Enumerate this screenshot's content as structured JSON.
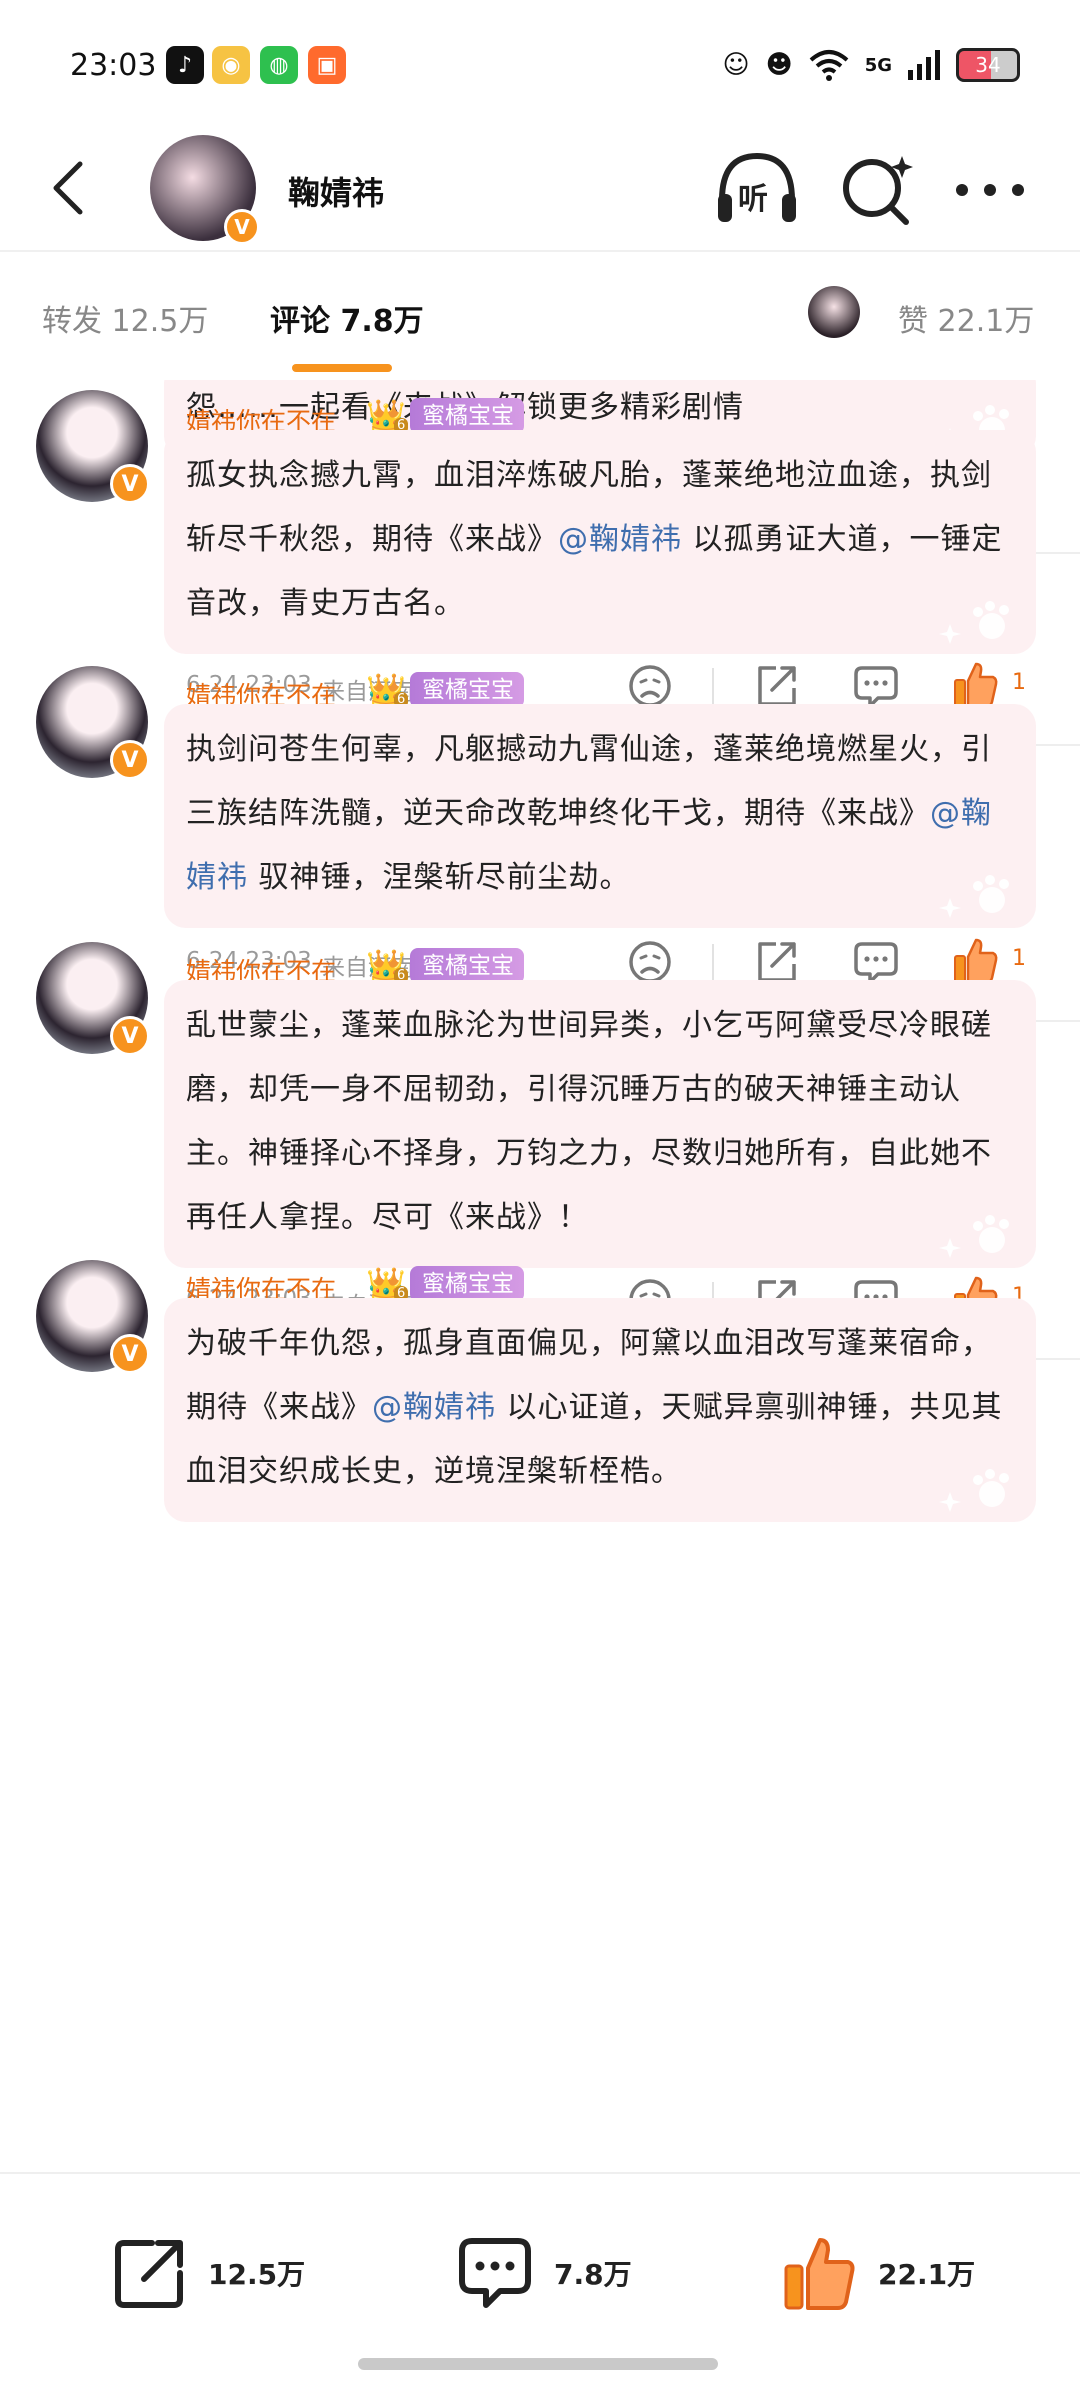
{
  "status_bar": {
    "time": "23:03",
    "network": "5G",
    "battery": "34",
    "app_icons": [
      "tiktok-icon",
      "weibo-icon",
      "wechat-icon",
      "camera-app-icon"
    ]
  },
  "header": {
    "title": "鞠婧祎",
    "listen_label": "听",
    "verified_mark": "V"
  },
  "tabs": {
    "forward": "转发 12.5万",
    "comment": "评论 7.8万",
    "like": "赞 22.1万"
  },
  "accent_color": "#f7931e",
  "comments": [
    {
      "name": "",
      "badge": "",
      "medal_level": "",
      "text_parts": [
        {
          "t": "怨……一起看《来战》解锁更多精彩剧情",
          "m": false
        }
      ],
      "time": "6-24 23:03",
      "location": "来自河南",
      "likes": "1"
    },
    {
      "name": "婧祎你在不在_",
      "badge": "蜜橘宝宝",
      "medal_level": "6",
      "text_parts": [
        {
          "t": "孤女执念撼九霄，血泪淬炼破凡胎，蓬莱绝地泣血途，执剑斩尽千秋怨，期待《来战》",
          "m": false
        },
        {
          "t": "@鞠婧祎",
          "m": true
        },
        {
          "t": " 以孤勇证大道，一锤定音改，青史万古名。",
          "m": false
        }
      ],
      "time": "6-24 23:03",
      "location": "来自河南",
      "likes": "1"
    },
    {
      "name": "婧祎你在不在_",
      "badge": "蜜橘宝宝",
      "medal_level": "6",
      "text_parts": [
        {
          "t": "执剑问苍生何辜，凡躯撼动九霄仙途，蓬莱绝境燃星火，引三族结阵洗髓，逆天命改乾坤终化干戈，期待《来战》",
          "m": false
        },
        {
          "t": "@鞠婧祎",
          "m": true
        },
        {
          "t": " 驭神锤，涅槃斩尽前尘劫。",
          "m": false
        }
      ],
      "time": "6-24 23:03",
      "location": "来自河南",
      "likes": "1"
    },
    {
      "name": "婧祎你在不在_",
      "badge": "蜜橘宝宝",
      "medal_level": "6",
      "text_parts": [
        {
          "t": "乱世蒙尘，蓬莱血脉沦为世间异类，小乞丐阿黛受尽冷眼磋磨，却凭一身不屈韧劲，引得沉睡万古的破天神锤主动认主。神锤择心不择身，万钧之力，尽数归她所有，自此她不再任人拿捏。尽可《来战》！",
          "m": false
        }
      ],
      "time": "6-24 23:03",
      "location": "来自河南",
      "likes": "1"
    },
    {
      "name": "婧祎你在不在_",
      "badge": "蜜橘宝宝",
      "medal_level": "6",
      "text_parts": [
        {
          "t": "为破千年仇怨，孤身直面偏见，阿黛以血泪改写蓬莱宿命，期待《来战》",
          "m": false
        },
        {
          "t": "@鞠婧祎",
          "m": true
        },
        {
          "t": " 以心证道，天赋异禀驯神锤，共见其血泪交织成长史，逆境涅槃斩桎梏。",
          "m": false
        }
      ],
      "time": "",
      "location": "",
      "likes": ""
    }
  ],
  "bottom_bar": {
    "forward": "12.5万",
    "comment": "7.8万",
    "like": "22.1万"
  }
}
